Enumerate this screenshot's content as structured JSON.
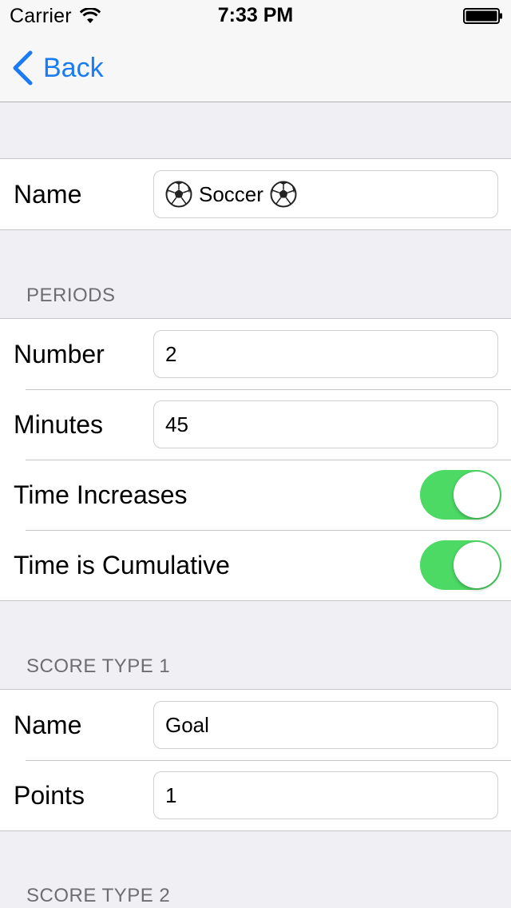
{
  "status_bar": {
    "carrier": "Carrier",
    "time": "7:33 PM"
  },
  "nav": {
    "back_label": "Back"
  },
  "main_name": {
    "label": "Name",
    "value": "Soccer",
    "icons": [
      "soccer-ball-icon",
      "soccer-ball-icon"
    ]
  },
  "periods": {
    "header": "PERIODS",
    "number_label": "Number",
    "number_value": "2",
    "minutes_label": "Minutes",
    "minutes_value": "45",
    "time_increases_label": "Time Increases",
    "time_increases_on": true,
    "time_cumulative_label": "Time is Cumulative",
    "time_cumulative_on": true
  },
  "score_type_1": {
    "header": "SCORE TYPE 1",
    "name_label": "Name",
    "name_value": "Goal",
    "points_label": "Points",
    "points_value": "1"
  },
  "score_type_2": {
    "header": "SCORE TYPE 2"
  },
  "colors": {
    "accent": "#1a7cf5",
    "toggle_on": "#4cd964",
    "background": "#efeff4"
  }
}
